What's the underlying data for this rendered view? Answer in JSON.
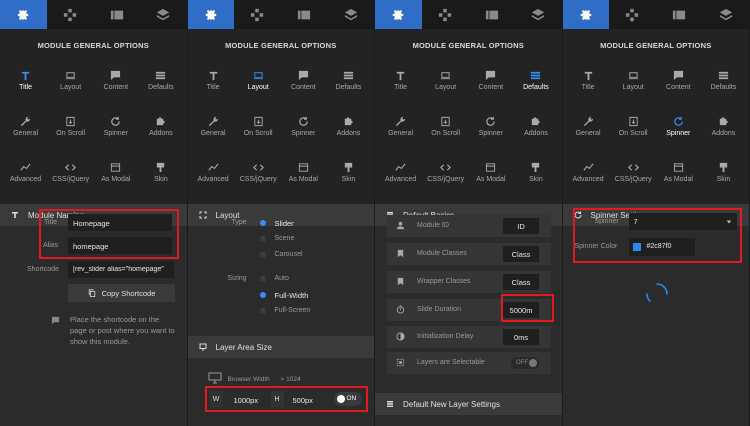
{
  "tabs": [
    {
      "name": "gear-icon"
    },
    {
      "name": "move-icon"
    },
    {
      "name": "layers-grid-icon"
    },
    {
      "name": "stack-icon"
    }
  ],
  "general_title": "MODULE GENERAL OPTIONS",
  "grid_items": [
    "Title",
    "Layout",
    "Content",
    "Defaults",
    "General",
    "On Scroll",
    "Spinner",
    "Addons",
    "Advanced",
    "CSS/jQuery",
    "As Modal",
    "Skin"
  ],
  "panel1": {
    "section": "Module Naming",
    "title_label": "Title",
    "title_value": "Homepage",
    "alias_label": "Alias",
    "alias_value": "homepage",
    "shortcode_label": "Shortcode",
    "shortcode_value": "[rev_slider alias=\"homepage\"",
    "copy_button": "Copy Shortcode",
    "hint": "Place the shortcode on the page or post where you want to show this module."
  },
  "panel2": {
    "section": "Layout",
    "type_label": "Type",
    "types": [
      "Slider",
      "Scene",
      "Carousel"
    ],
    "sizing_label": "Sizing",
    "sizings": [
      "Auto",
      "Full-Width",
      "Full-Screen"
    ],
    "section2": "Layer Area Size",
    "browser_width": "Browser Width",
    "browser_width_value": "> 1024",
    "w_label": "W",
    "w_value": "1000px",
    "h_label": "H",
    "h_value": "500px",
    "toggle": "ON"
  },
  "panel3": {
    "section": "Default Basics",
    "rows": [
      {
        "label": "Module ID",
        "value": "ID"
      },
      {
        "label": "Module Classes",
        "value": "Class"
      },
      {
        "label": "Wrapper Classes",
        "value": "Class"
      },
      {
        "label": "Slide Duration",
        "value": "5000m"
      },
      {
        "label": "Initialization Delay",
        "value": "0ms"
      },
      {
        "label": "Layers are Selectable",
        "value": "OFF"
      }
    ],
    "section2": "Default New Layer Settings"
  },
  "panel4": {
    "section": "Spinner Settings",
    "spinner_label": "Spinner",
    "spinner_value": "7",
    "color_label": "Spinner Color",
    "color_value": "#2c87f0"
  },
  "colors": {
    "accent": "#2f6dc6",
    "highlight": "#e11a22",
    "spinner": "#2c87f0"
  }
}
